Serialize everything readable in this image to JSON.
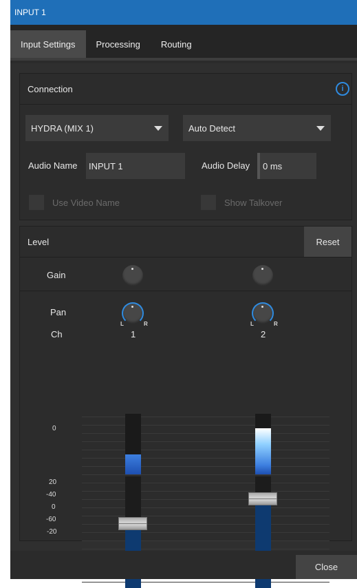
{
  "window": {
    "title": "INPUT 1"
  },
  "tabs": [
    {
      "label": "Input Settings",
      "active": true
    },
    {
      "label": "Processing",
      "active": false
    },
    {
      "label": "Routing",
      "active": false
    }
  ],
  "connection": {
    "title": "Connection",
    "info_icon": "i",
    "source_dropdown": "HYDRA (MIX 1)",
    "mode_dropdown": "Auto Detect",
    "audio_name_label": "Audio Name",
    "audio_name_value": "INPUT 1",
    "audio_delay_label": "Audio Delay",
    "audio_delay_value": "0 ms",
    "use_video_name_label": "Use Video Name",
    "show_talkover_label": "Show Talkover"
  },
  "level": {
    "title": "Level",
    "reset_label": "Reset",
    "gain_label": "Gain",
    "pan_label": "Pan",
    "ch_label": "Ch",
    "pan_l": "L",
    "pan_r": "R",
    "channels": [
      {
        "number": "1",
        "meter_level": 0.33,
        "fader_position": 0.58
      },
      {
        "number": "2",
        "meter_level": 0.76,
        "fader_position": 0.8
      }
    ],
    "meter_scale": [
      "0"
    ],
    "fader_scale": [
      "20",
      "0",
      "-20",
      "-40",
      "-60"
    ]
  },
  "footer": {
    "close_label": "Close"
  },
  "colors": {
    "titlebar": "#1f6fb8",
    "accent": "#2f8be0",
    "fader_fill": "#0e3a70"
  }
}
